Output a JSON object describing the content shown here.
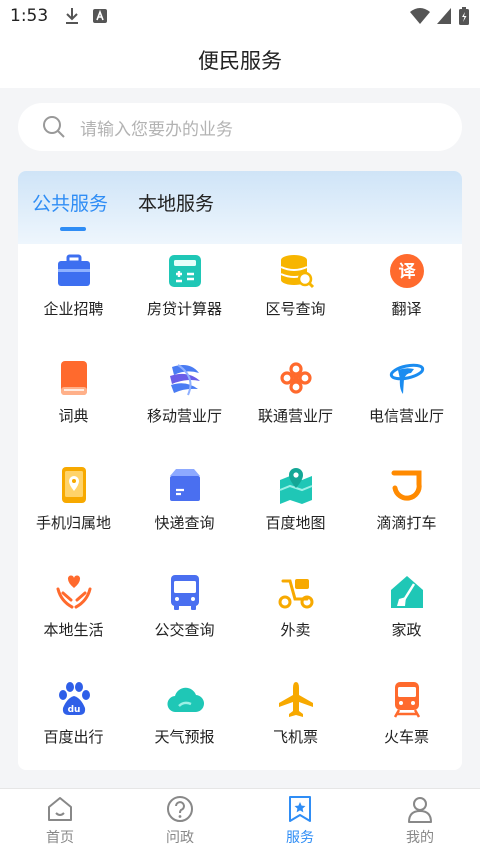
{
  "status_bar": {
    "time": "1:53"
  },
  "header": {
    "title": "便民服务"
  },
  "search": {
    "placeholder": "请输入您要办的业务"
  },
  "tabs": [
    {
      "label": "公共服务",
      "active": true
    },
    {
      "label": "本地服务",
      "active": false
    }
  ],
  "services": [
    {
      "label": "企业招聘",
      "icon": "briefcase-icon"
    },
    {
      "label": "房贷计算器",
      "icon": "calculator-icon"
    },
    {
      "label": "区号查询",
      "icon": "database-search-icon"
    },
    {
      "label": "翻译",
      "icon": "translate-icon"
    },
    {
      "label": "词典",
      "icon": "dictionary-icon"
    },
    {
      "label": "移动营业厅",
      "icon": "china-mobile-icon"
    },
    {
      "label": "联通营业厅",
      "icon": "china-unicom-icon"
    },
    {
      "label": "电信营业厅",
      "icon": "china-telecom-icon"
    },
    {
      "label": "手机归属地",
      "icon": "phone-location-icon"
    },
    {
      "label": "快递查询",
      "icon": "package-icon"
    },
    {
      "label": "百度地图",
      "icon": "map-icon"
    },
    {
      "label": "滴滴打车",
      "icon": "didi-icon"
    },
    {
      "label": "本地生活",
      "icon": "hands-heart-icon"
    },
    {
      "label": "公交查询",
      "icon": "bus-icon"
    },
    {
      "label": "外卖",
      "icon": "scooter-icon"
    },
    {
      "label": "家政",
      "icon": "house-broom-icon"
    },
    {
      "label": "百度出行",
      "icon": "baidu-paw-icon"
    },
    {
      "label": "天气预报",
      "icon": "cloud-icon"
    },
    {
      "label": "飞机票",
      "icon": "airplane-icon"
    },
    {
      "label": "火车票",
      "icon": "train-icon"
    }
  ],
  "nav": [
    {
      "label": "首页",
      "icon": "home-icon",
      "active": false
    },
    {
      "label": "问政",
      "icon": "question-icon",
      "active": false
    },
    {
      "label": "服务",
      "icon": "star-bookmark-icon",
      "active": true
    },
    {
      "label": "我的",
      "icon": "user-icon",
      "active": false
    }
  ],
  "colors": {
    "accent": "#2f8df5",
    "text": "#222222",
    "muted": "#888888"
  }
}
